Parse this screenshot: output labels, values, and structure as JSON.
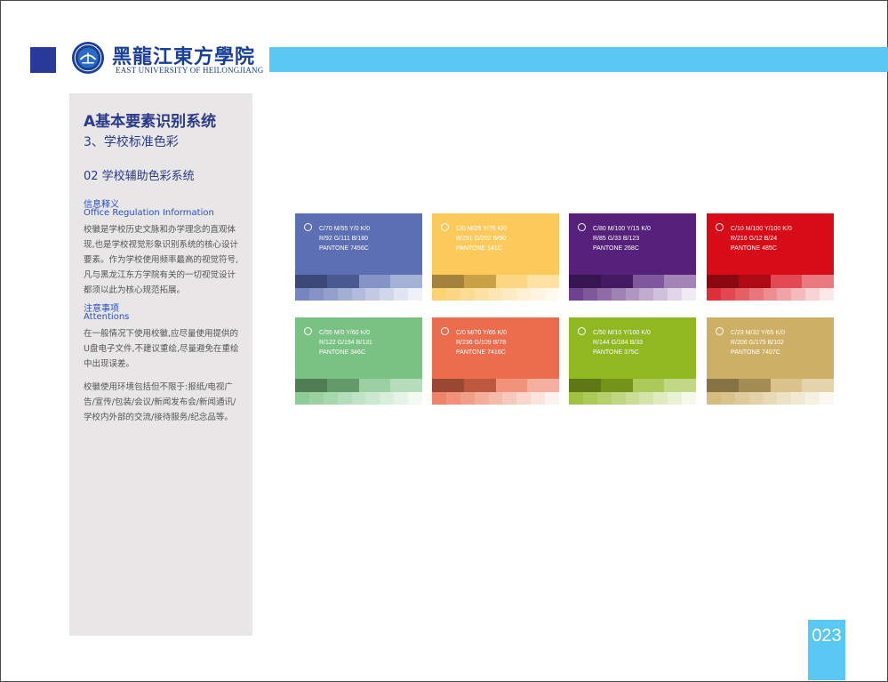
{
  "header": {
    "school_name_cn": "黑龍江東方學院",
    "school_name_en": "EAST UNIVERSITY OF HEILONGJIANG",
    "accent_color": "#5ac8f4",
    "brand_color": "#1a3f99"
  },
  "sidebar": {
    "title": "A基本要素识别系统",
    "subtitle": "3、学校标准色彩",
    "section": "02 学校辅助色彩系统",
    "heading1_cn": "信息释义",
    "heading1_en": "Office Regulation Information",
    "para1": "校徽是学校历史文脉和办学理念的直观体现,也是学校视觉形象识别系统的核心设计要素。作为学校使用频率最高的视觉符号,凡与黑龙江东方学院有关的一切视觉设计都须以此为核心规范拓展。",
    "heading2_cn": "注意事项",
    "heading2_en": "Attentions",
    "para2": "在一般情况下使用校徽,应尽量使用提供的U盘电子文件,不建议重绘,尽量避免在重绘中出现误差。",
    "para3": "校徽使用环境包括但不限于:报纸/电视广告/宣传/包装/会议/新闻发布会/新闻通讯/学校内外部的交流/接待服务/纪念品等。"
  },
  "swatches": [
    {
      "cmyk": "C/70  M/55  Y/0  K/0",
      "rgb": "R/92   G/111   B/180",
      "pantone": "PANTONE 7456C",
      "color": "#5c6fb4"
    },
    {
      "cmyk": "C/0  M/25  Y/70  K/0",
      "rgb": "R/251   G/202   B/90",
      "pantone": "PANTONE 141C",
      "color": "#fbca5a"
    },
    {
      "cmyk": "C/80  M/100  Y/15  K/0",
      "rgb": "R/85   G/33   B/123",
      "pantone": "PANTONE 268C",
      "color": "#55217b"
    },
    {
      "cmyk": "C/10  M/100  Y/100  K/0",
      "rgb": "R/216   G/12   B/24",
      "pantone": "PANTONE 485C",
      "color": "#d80c18"
    },
    {
      "cmyk": "C/55  M/0  Y/60  K/0",
      "rgb": "R/122   G/194   B/131",
      "pantone": "PANTONE 346C",
      "color": "#7ac283"
    },
    {
      "cmyk": "C/0  M/70  Y/65  K/0",
      "rgb": "R/236   G/109   B/78",
      "pantone": "PANTONE 7416C",
      "color": "#ec6d4e"
    },
    {
      "cmyk": "C/50  M/10  Y/100  K/0",
      "rgb": "R/144   G/184   B/33",
      "pantone": "PANTONE 375C",
      "color": "#90b821"
    },
    {
      "cmyk": "C/23  M/32  Y/65  K/0",
      "rgb": "R/206   G/175   B/102",
      "pantone": "PANTONE 7407C",
      "color": "#ceaf66"
    }
  ],
  "page_number": "023"
}
